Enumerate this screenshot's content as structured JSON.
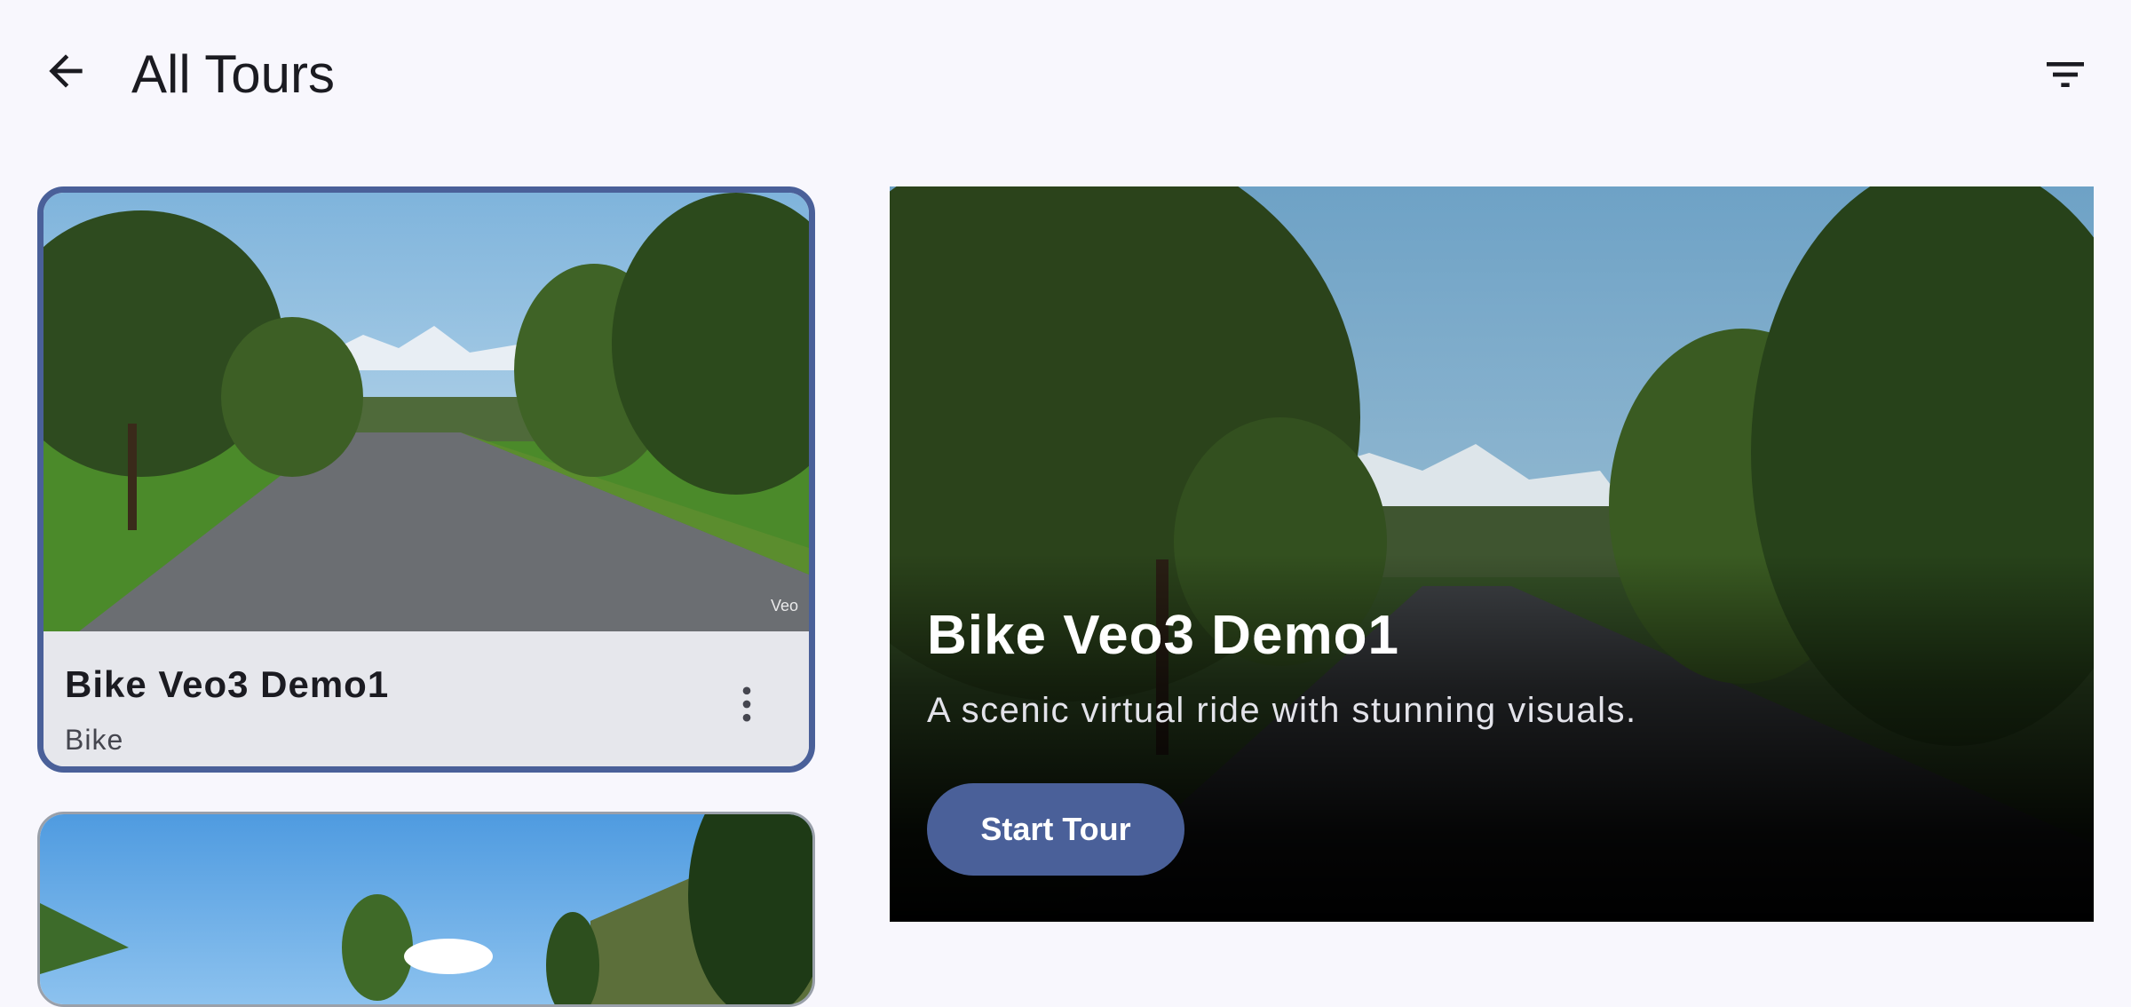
{
  "app_bar": {
    "title": "All Tours",
    "back_icon": "arrow-back-icon",
    "filter_icon": "filter-icon"
  },
  "tours": [
    {
      "title": "Bike Veo3 Demo1",
      "category": "Bike",
      "watermark": "Veo",
      "selected": true,
      "more_icon": "more-vert-icon"
    },
    {
      "title": "",
      "category": "",
      "selected": false
    }
  ],
  "detail": {
    "title": "Bike Veo3 Demo1",
    "description": "A scenic virtual ride with stunning visuals.",
    "start_label": "Start Tour"
  },
  "colors": {
    "background": "#f8f7fd",
    "accent": "#4a6099",
    "card_surface": "#e6e7ec",
    "text_primary": "#1b1b21",
    "text_secondary": "#45464f"
  }
}
